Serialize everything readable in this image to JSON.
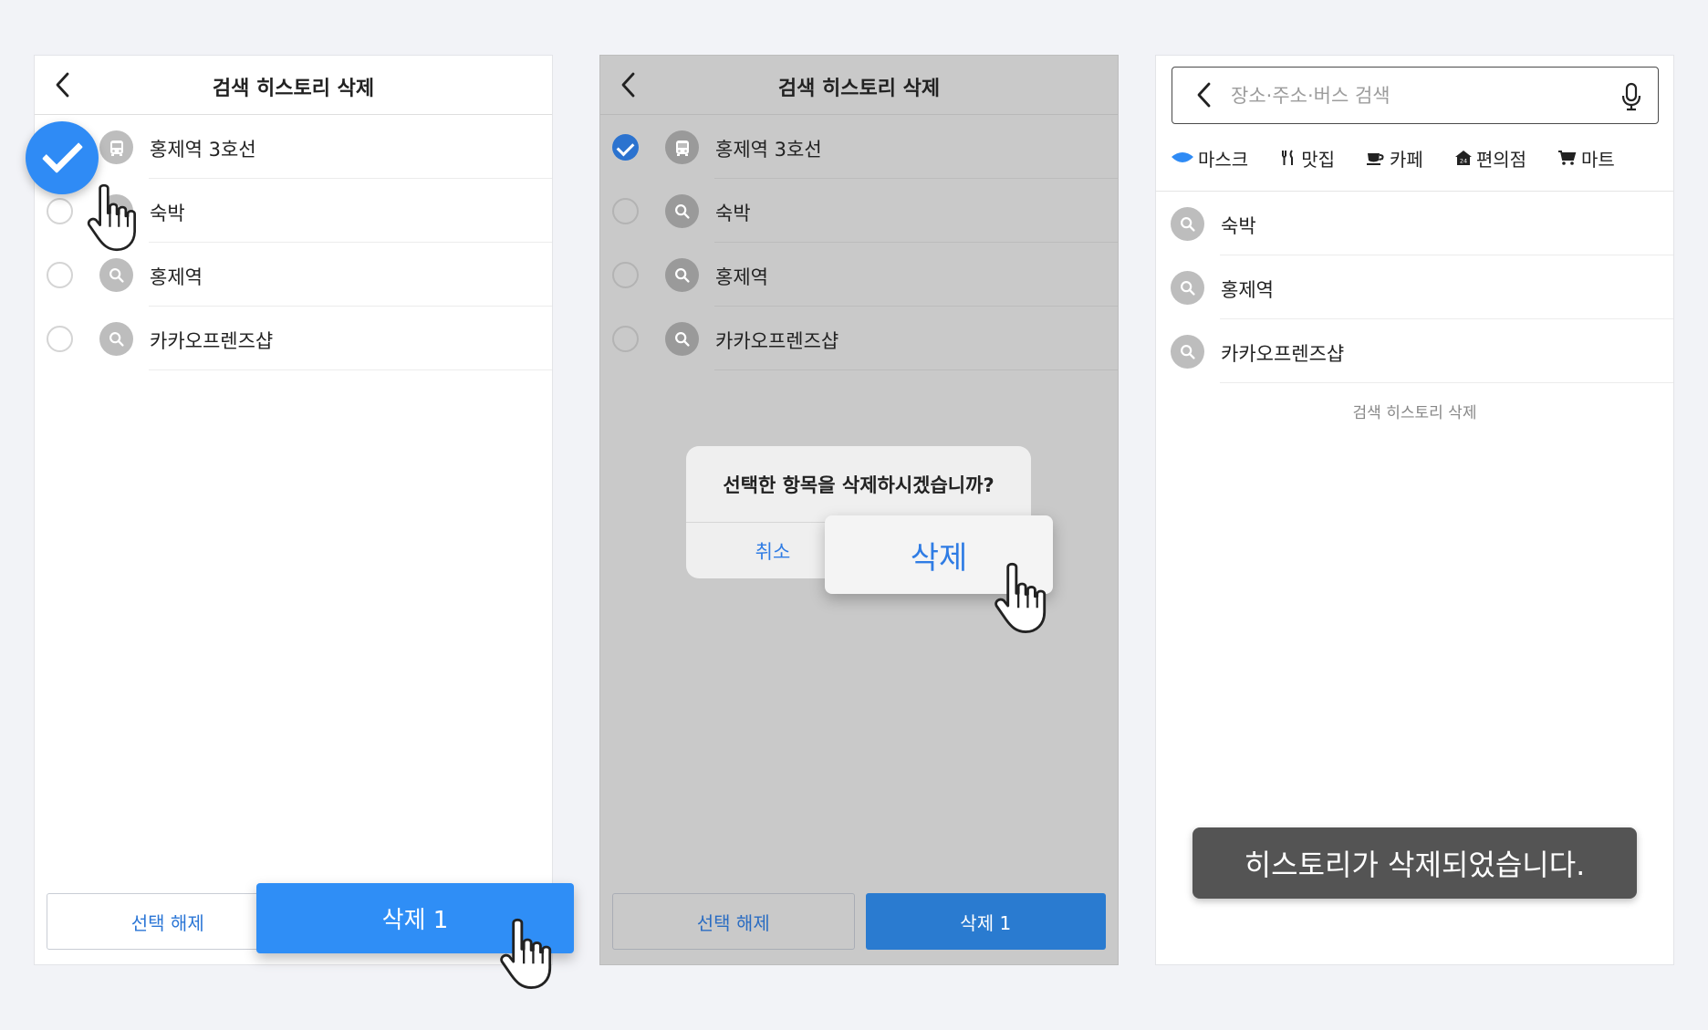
{
  "screen1": {
    "title": "검색 히스토리 삭제",
    "items": [
      {
        "label": "홍제역 3호선",
        "icon": "bus-icon",
        "checked": true
      },
      {
        "label": "숙박",
        "icon": "search-icon",
        "checked": false
      },
      {
        "label": "홍제역",
        "icon": "search-icon",
        "checked": false
      },
      {
        "label": "카카오프렌즈샵",
        "icon": "search-icon",
        "checked": false
      }
    ],
    "deselect_label": "선택 해제",
    "delete_label": "삭제 1"
  },
  "screen2": {
    "title": "검색 히스토리 삭제",
    "items": [
      {
        "label": "홍제역 3호선",
        "icon": "bus-icon",
        "checked": true
      },
      {
        "label": "숙박",
        "icon": "search-icon",
        "checked": false
      },
      {
        "label": "홍제역",
        "icon": "search-icon",
        "checked": false
      },
      {
        "label": "카카오프렌즈샵",
        "icon": "search-icon",
        "checked": false
      }
    ],
    "dialog": {
      "message": "선택한 항목을 삭제하시겠습니까?",
      "cancel_label": "취소",
      "confirm_label": "삭제"
    },
    "deselect_label": "선택 해제",
    "delete_label": "삭제 1"
  },
  "screen3": {
    "search_placeholder": "장소·주소·버스 검색",
    "categories": [
      "마스크",
      "맛집",
      "카페",
      "편의점",
      "마트"
    ],
    "items": [
      {
        "label": "숙박",
        "icon": "search-icon"
      },
      {
        "label": "홍제역",
        "icon": "search-icon"
      },
      {
        "label": "카카오프렌즈샵",
        "icon": "search-icon"
      }
    ],
    "history_delete_label": "검색 히스토리 삭제",
    "toast": "히스토리가 삭제되었습니다."
  },
  "colors": {
    "accent": "#2f8bf5",
    "button_blue": "#2a7bd0",
    "dim_overlay": "#c9c9c9",
    "toast_bg": "#545454"
  }
}
